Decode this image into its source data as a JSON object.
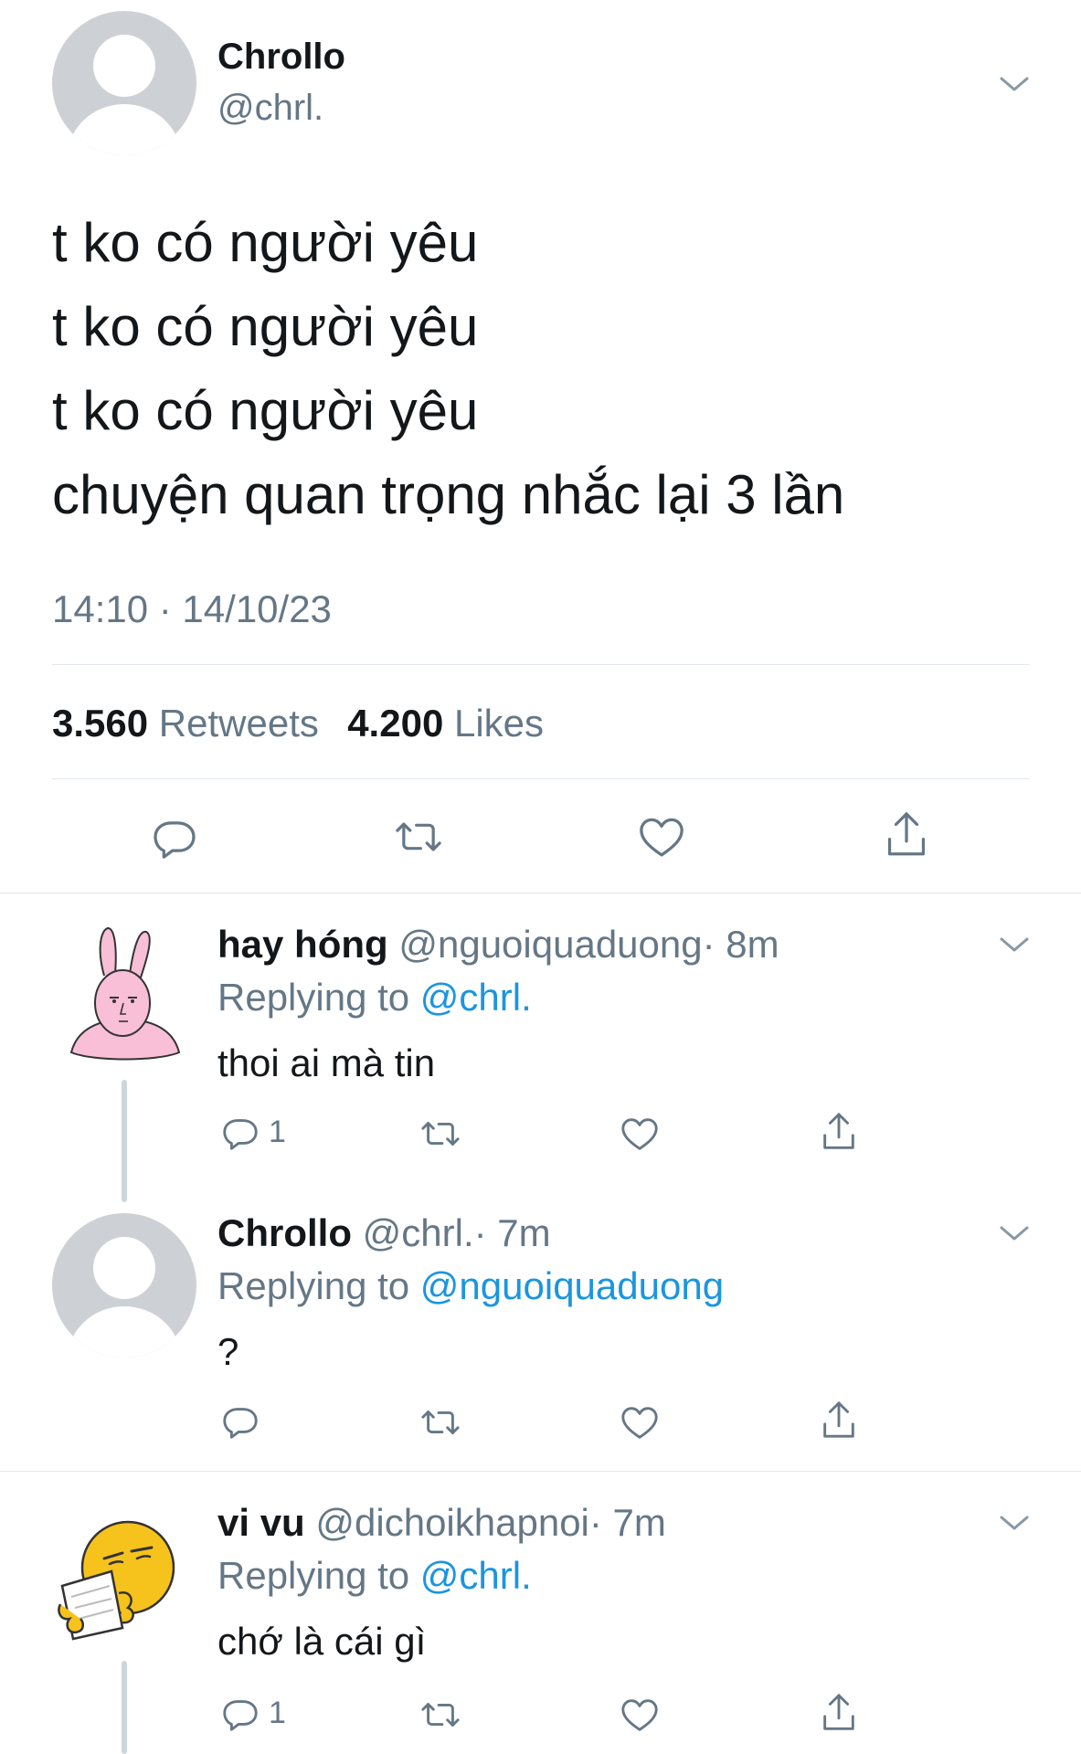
{
  "main_tweet": {
    "name": "Chrollo",
    "handle": "@chrl.",
    "lines": [
      "t ko có người yêu",
      "t ko có người yêu",
      "t ko có người yêu",
      "chuyện quan trọng nhắc lại 3 lần"
    ],
    "timestamp": "14:10 · 14/10/23",
    "retweets_count": "3.560",
    "retweets_label": "Retweets",
    "likes_count": "4.200",
    "likes_label": "Likes"
  },
  "replies": [
    {
      "name": "hay hóng",
      "handle": "@nguoiquaduong",
      "time": "· 8m",
      "replying_prefix": "Replying to",
      "replying_to": "@chrl.",
      "text": "thoi ai mà tin",
      "reply_count": "1"
    },
    {
      "name": "Chrollo",
      "handle": "@chrl.",
      "time": "· 7m",
      "replying_prefix": "Replying to",
      "replying_to": "@nguoiquaduong",
      "text": "?",
      "reply_count": ""
    },
    {
      "name": "vi vu",
      "handle": "@dichoikhapnoi",
      "time": "· 7m",
      "replying_prefix": "Replying to",
      "replying_to": "@chrl.",
      "text": "chớ là cái gì",
      "reply_count": "1"
    }
  ],
  "colors": {
    "text": "#14171a",
    "secondary": "#657786",
    "link": "#1b95e0",
    "divider": "#e1e8ed",
    "icon": "#657786",
    "avatar_default": "#cdd1d5"
  },
  "icons": {
    "reply": "comment-icon",
    "retweet": "retweet-icon",
    "like": "heart-icon",
    "share": "share-icon",
    "menu": "chevron-down-icon"
  }
}
